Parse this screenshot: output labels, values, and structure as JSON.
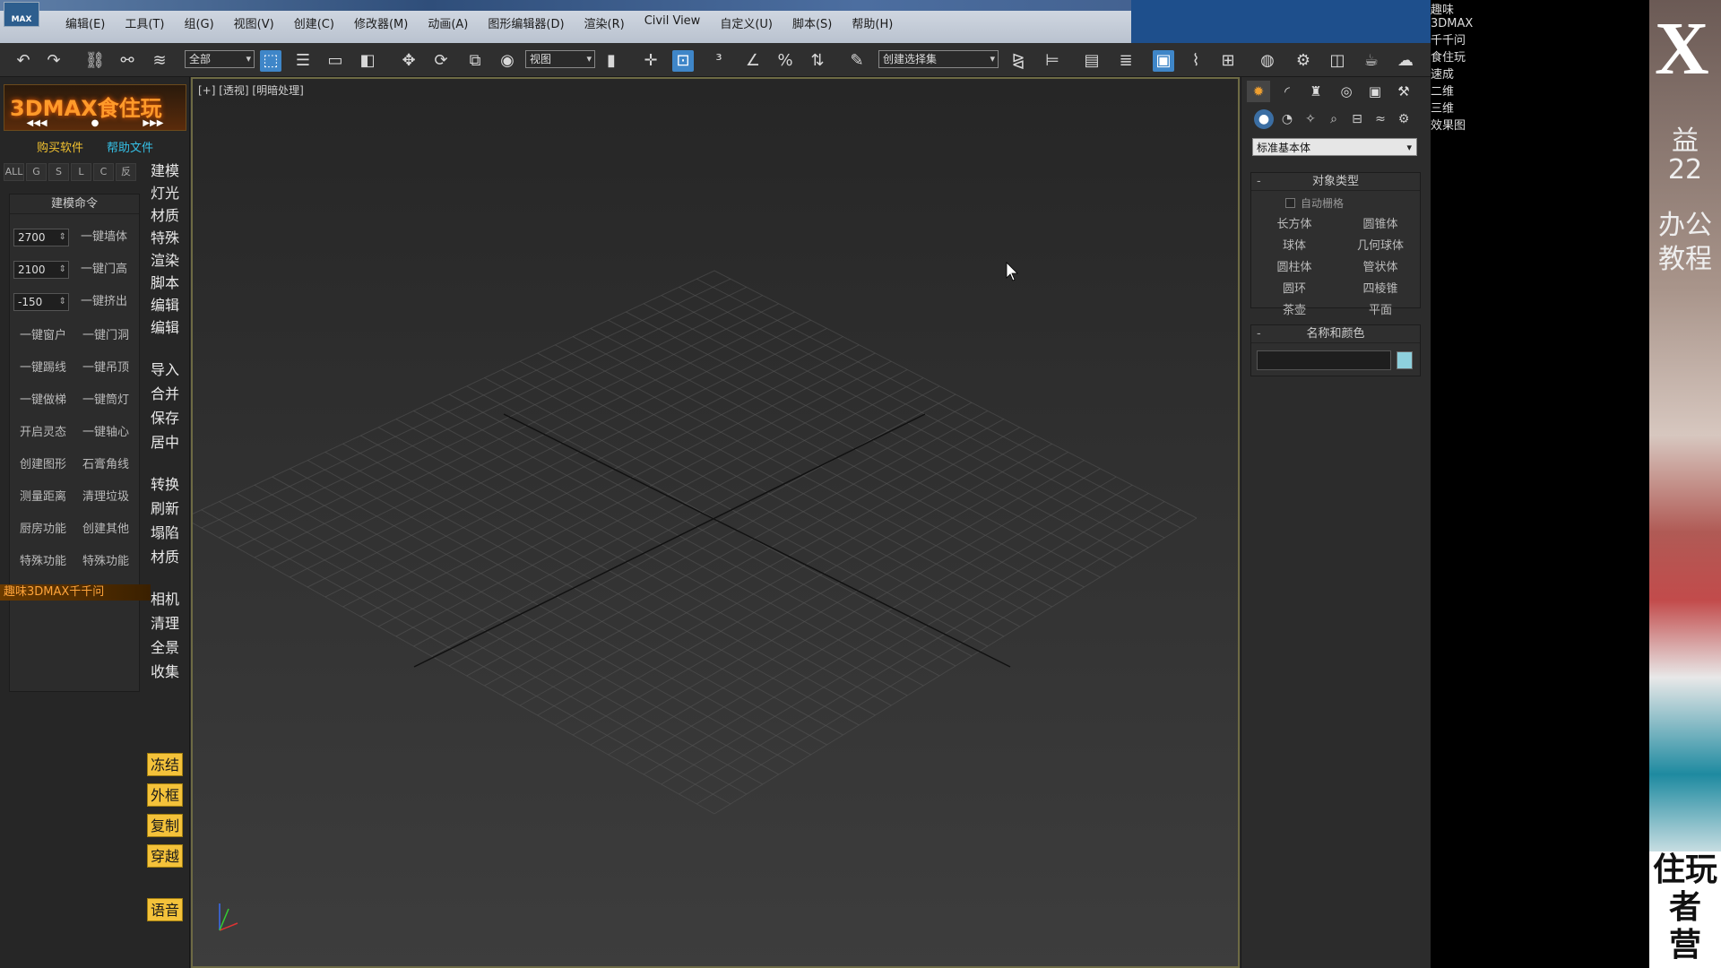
{
  "menubar": {
    "logo": "MAX",
    "items": [
      "编辑(E)",
      "工具(T)",
      "组(G)",
      "视图(V)",
      "创建(C)",
      "修改器(M)",
      "动画(A)",
      "图形编辑器(D)",
      "渲染(R)",
      "Civil View",
      "自定义(U)",
      "脚本(S)",
      "帮助(H)"
    ]
  },
  "toolbar": {
    "selection_filter": "全部",
    "ref_coord": "视图",
    "named_selection": "创建选择集"
  },
  "plugin": {
    "banner": "3DMAX食住玩",
    "banner_controls": [
      "◀◀◀",
      "●",
      "▶▶▶"
    ],
    "buy": "购买软件",
    "help": "帮助文件",
    "filters": [
      "ALL",
      "G",
      "S",
      "L",
      "C",
      "反"
    ],
    "cmd_header": "建模命令",
    "wall_height": "2700",
    "door_height": "2100",
    "extrude": "-150",
    "btn_wall": "一键墙体",
    "btn_door_height": "一键门高",
    "btn_extrude": "一键挤出",
    "grid_buttons": [
      [
        "一键窗户",
        "一键门洞"
      ],
      [
        "一键踢线",
        "一键吊顶"
      ],
      [
        "一键做梯",
        "一键筒灯"
      ],
      [
        "开启灵态",
        "一键轴心"
      ],
      [
        "创建图形",
        "石膏角线"
      ],
      [
        "测量距离",
        "清理垃圾"
      ],
      [
        "厨房功能",
        "创建其他"
      ],
      [
        "特殊功能",
        "特殊功能"
      ]
    ],
    "orange_bar": "趣味3DMAX千千问",
    "vertical_buttons_a": [
      "建模",
      "灯光",
      "材质",
      "特殊",
      "渲染",
      "脚本",
      "编辑",
      "编辑"
    ],
    "vertical_buttons_b": [
      "导入",
      "合并",
      "保存",
      "居中"
    ],
    "vertical_buttons_c": [
      "转换",
      "刷新",
      "塌陷",
      "材质"
    ],
    "vertical_buttons_d": [
      "相机",
      "清理",
      "全景",
      "收集"
    ],
    "yellow_buttons": [
      "冻结",
      "外框",
      "复制",
      "穿越"
    ],
    "voice": "语音"
  },
  "viewport": {
    "label": "[+] [透视] [明暗处理]"
  },
  "command_panel": {
    "dropdown": "标准基本体",
    "object_type_header": "对象类型",
    "autogrid": "自动栅格",
    "primitives": [
      "长方体",
      "圆锥体",
      "球体",
      "几何球体",
      "圆柱体",
      "管状体",
      "圆环",
      "四棱锥",
      "茶壶",
      "平面"
    ],
    "name_color_header": "名称和颜色",
    "swatch_color": "#8ed0dd"
  },
  "promo": {
    "lines": [
      "趣味",
      "3DMAX",
      "千千问",
      "食住玩",
      "速成",
      "二维",
      "三维",
      "效果图"
    ]
  },
  "side": {
    "big_letter": "X",
    "vertical_text": [
      "益",
      "22",
      "办公",
      "教程"
    ],
    "bottom_text": [
      "住玩",
      "者",
      "营"
    ]
  }
}
